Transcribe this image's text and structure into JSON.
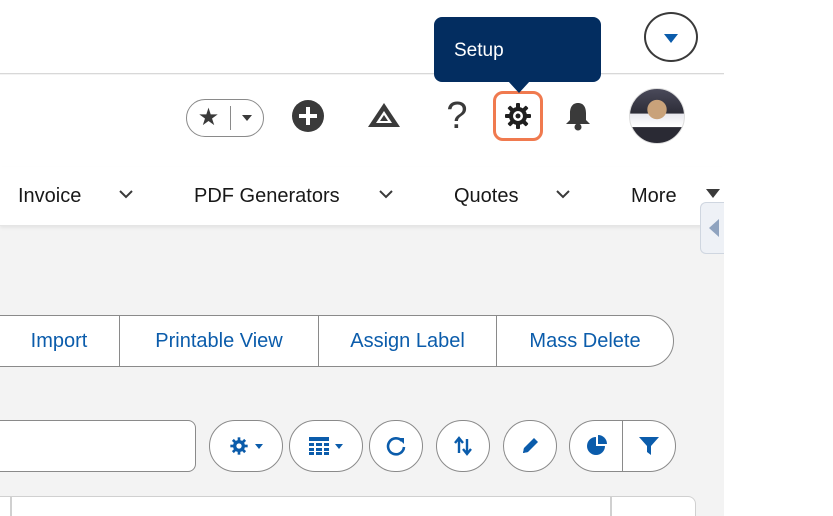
{
  "tooltip": {
    "text": "Setup"
  },
  "header": {
    "favorites_icon": "star-icon",
    "icons": [
      "plus-circle-icon",
      "trailhead-icon",
      "help-icon",
      "gear-icon",
      "bell-icon"
    ],
    "help_glyph": "?",
    "setup_highlight_color": "#f07a4f"
  },
  "nav": {
    "items": [
      {
        "label": "Invoice"
      },
      {
        "label": "PDF Generators"
      },
      {
        "label": "Quotes"
      },
      {
        "label": "More"
      }
    ]
  },
  "actions": {
    "buttons": [
      {
        "label": "Import"
      },
      {
        "label": "Printable View"
      },
      {
        "label": "Assign Label"
      },
      {
        "label": "Mass Delete"
      }
    ]
  },
  "toolbar": {
    "icons": [
      "gear-icon",
      "table-icon",
      "refresh-icon",
      "sort-icon",
      "pencil-icon",
      "pie-chart-icon",
      "filter-icon"
    ]
  },
  "colors": {
    "brand_blue": "#0b5cab",
    "tooltip_bg": "#032d60",
    "page_bg": "#f3f3f3"
  }
}
